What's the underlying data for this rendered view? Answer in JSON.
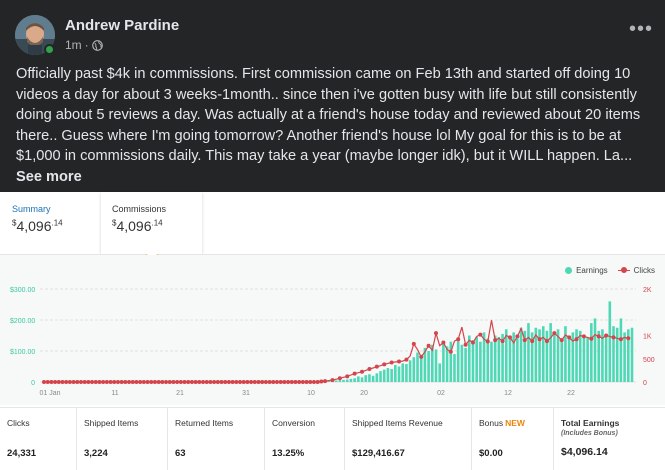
{
  "post": {
    "author": "Andrew Pardine",
    "time": "1m",
    "separator": "·",
    "text": "Officially past $4k in commissions. First commission came on Feb 13th and started off doing 10 videos a day for about 3 weeks-1month.. since then i've gotten busy with life but still consistently doing about 5 reviews a day. Was actually at a friend's house today and reviewed about 20 items there.. Guess where I'm going tomorrow? Another friend's house lol My goal for this is to be at $1,000 in commissions daily. This may take a year (maybe longer idk), but it WILL happen. La...",
    "see_more": "See more",
    "more_icon": "ellipsis-icon",
    "privacy_icon": "globe-icon"
  },
  "tabs": {
    "summary": {
      "label": "Summary",
      "currency": "$",
      "whole": "4,096",
      "cents": ".14"
    },
    "commissions": {
      "label": "Commissions",
      "currency": "$",
      "whole": "4,096",
      "cents": ".14"
    }
  },
  "colors": {
    "bars": "#4fd8b6",
    "line": "#d4454b",
    "tab_accent": "#1a73b8",
    "post_bg": "#242526"
  },
  "chart_data": {
    "type": "bar",
    "legend": [
      {
        "name": "Earnings",
        "marker": "bar"
      },
      {
        "name": "Clicks",
        "marker": "line"
      }
    ],
    "legend_position": "top-right",
    "x_tick_labels": [
      "01 Jan",
      "11",
      "21",
      "31",
      "10",
      "20",
      "02",
      "12",
      "22"
    ],
    "left_axis": {
      "ticks": [
        "$300.00",
        "$200.00",
        "$100.00",
        "0"
      ],
      "values": [
        300,
        200,
        100,
        0
      ],
      "range": [
        0,
        300
      ]
    },
    "right_axis": {
      "ticks": [
        "2K",
        "1K",
        "500",
        "0"
      ],
      "values": [
        2000,
        1000,
        500,
        0
      ],
      "range": [
        0,
        2000
      ]
    },
    "grid": true,
    "series": [
      {
        "name": "Earnings",
        "type": "bar",
        "values": [
          0,
          0,
          0,
          0,
          0,
          0,
          0,
          0,
          0,
          0,
          0,
          0,
          0,
          0,
          0,
          0,
          0,
          0,
          0,
          0,
          0,
          0,
          0,
          0,
          0,
          0,
          0,
          0,
          0,
          0,
          0,
          0,
          0,
          0,
          0,
          0,
          0,
          0,
          0,
          0,
          0,
          0,
          0,
          0,
          0,
          0,
          0,
          0,
          0,
          0,
          0,
          0,
          0,
          0,
          0,
          0,
          0,
          0,
          0,
          0,
          0,
          0,
          0,
          0,
          0,
          0,
          0,
          0,
          0,
          0,
          0,
          0,
          0,
          0,
          0,
          0,
          2,
          3,
          4,
          5,
          6,
          7,
          8,
          10,
          12,
          18,
          15,
          22,
          25,
          20,
          28,
          35,
          40,
          45,
          42,
          55,
          50,
          60,
          58,
          70,
          80,
          95,
          85,
          110,
          100,
          120,
          105,
          60,
          125,
          115,
          130,
          90,
          140,
          120,
          110,
          150,
          135,
          145,
          130,
          160,
          140,
          130,
          150,
          145,
          155,
          170,
          150,
          160,
          140,
          175,
          165,
          190,
          160,
          175,
          170,
          180,
          165,
          190,
          155,
          170,
          130,
          180,
          145,
          160,
          170,
          165,
          150,
          145,
          190,
          205,
          165,
          170,
          150,
          260,
          180,
          175,
          205,
          160,
          170,
          175
        ],
        "values_note_order": "chronological"
      },
      {
        "name": "Clicks",
        "type": "line",
        "values": [
          0,
          0,
          0,
          0,
          0,
          0,
          0,
          0,
          0,
          0,
          0,
          0,
          0,
          0,
          0,
          0,
          0,
          0,
          0,
          0,
          0,
          0,
          0,
          0,
          0,
          0,
          0,
          0,
          0,
          0,
          0,
          0,
          0,
          0,
          0,
          0,
          0,
          0,
          0,
          0,
          0,
          0,
          0,
          0,
          0,
          0,
          0,
          0,
          0,
          0,
          0,
          0,
          0,
          0,
          0,
          0,
          0,
          0,
          0,
          0,
          0,
          0,
          0,
          0,
          0,
          0,
          0,
          0,
          0,
          0,
          0,
          0,
          0,
          0,
          0,
          10,
          20,
          30,
          40,
          60,
          80,
          100,
          120,
          150,
          180,
          200,
          220,
          250,
          280,
          300,
          330,
          350,
          380,
          400,
          420,
          430,
          440,
          450,
          480,
          560,
          820,
          700,
          540,
          650,
          780,
          680,
          1050,
          780,
          850,
          700,
          650,
          880,
          920,
          1180,
          800,
          900,
          850,
          980,
          1020,
          920,
          870,
          1330,
          900,
          940,
          880,
          1000,
          960,
          840,
          980,
          1150,
          900,
          960,
          880,
          1010,
          920,
          960,
          880,
          950,
          1050,
          980,
          900,
          1010,
          960,
          880,
          920,
          1000,
          980,
          960,
          930,
          1020,
          980,
          940,
          1000,
          980,
          960,
          940,
          920,
          960,
          940
        ]
      }
    ]
  },
  "metrics": [
    {
      "label": "Clicks",
      "value": "24,331"
    },
    {
      "label": "Shipped Items",
      "value": "3,224"
    },
    {
      "label": "Returned Items",
      "value": "63"
    },
    {
      "label": "Conversion",
      "value": "13.25%"
    },
    {
      "label": "Shipped Items Revenue",
      "value": "$129,416.67"
    },
    {
      "label": "Bonus",
      "badge": "NEW",
      "value": "$0.00"
    },
    {
      "label": "Total Earnings",
      "sub": "(Includes Bonus)",
      "value": "$4,096.14"
    }
  ]
}
